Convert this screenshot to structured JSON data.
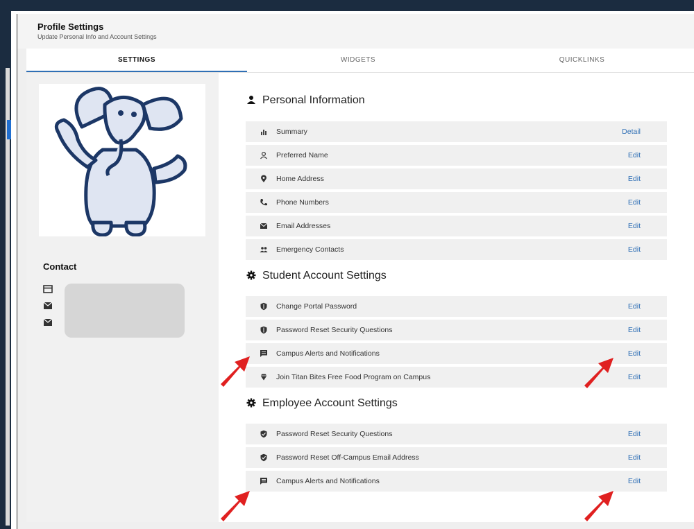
{
  "header": {
    "title": "Profile Settings",
    "subtitle": "Update Personal Info and Account Settings"
  },
  "tabs": [
    "SETTINGS",
    "WIDGETS",
    "QUICKLINKS"
  ],
  "contact": {
    "title": "Contact",
    "icons": [
      "card-icon",
      "mail-icon",
      "mail-icon"
    ]
  },
  "sections": [
    {
      "title": "Personal Information",
      "icon": "person-icon",
      "items": [
        {
          "icon": "bar-chart-icon",
          "label": "Summary",
          "action": "Detail"
        },
        {
          "icon": "person-outline-icon",
          "label": "Preferred Name",
          "action": "Edit"
        },
        {
          "icon": "location-pin-icon",
          "label": "Home Address",
          "action": "Edit"
        },
        {
          "icon": "phone-icon",
          "label": "Phone Numbers",
          "action": "Edit"
        },
        {
          "icon": "envelope-icon",
          "label": "Email Addresses",
          "action": "Edit"
        },
        {
          "icon": "people-icon",
          "label": "Emergency Contacts",
          "action": "Edit"
        }
      ]
    },
    {
      "title": "Student Account Settings",
      "icon": "gear-icon",
      "items": [
        {
          "icon": "shield-icon",
          "label": "Change Portal Password",
          "action": "Edit"
        },
        {
          "icon": "shield-icon",
          "label": "Password Reset Security Questions",
          "action": "Edit"
        },
        {
          "icon": "message-icon",
          "label": "Campus Alerts and Notifications",
          "action": "Edit"
        },
        {
          "icon": "diamond-icon",
          "label": "Join Titan Bites Free Food Program on Campus",
          "action": "Edit"
        }
      ]
    },
    {
      "title": "Employee Account Settings",
      "icon": "gear-icon",
      "items": [
        {
          "icon": "shield-icon",
          "label": "Password Reset Security Questions",
          "action": "Edit"
        },
        {
          "icon": "shield-icon",
          "label": "Password Reset Off-Campus Email Address",
          "action": "Edit"
        },
        {
          "icon": "message-icon",
          "label": "Campus Alerts and Notifications",
          "action": "Edit"
        }
      ]
    }
  ],
  "colors": {
    "link": "#2f6fb5",
    "arrow": "#e02020",
    "frame": "#1b2c40"
  }
}
